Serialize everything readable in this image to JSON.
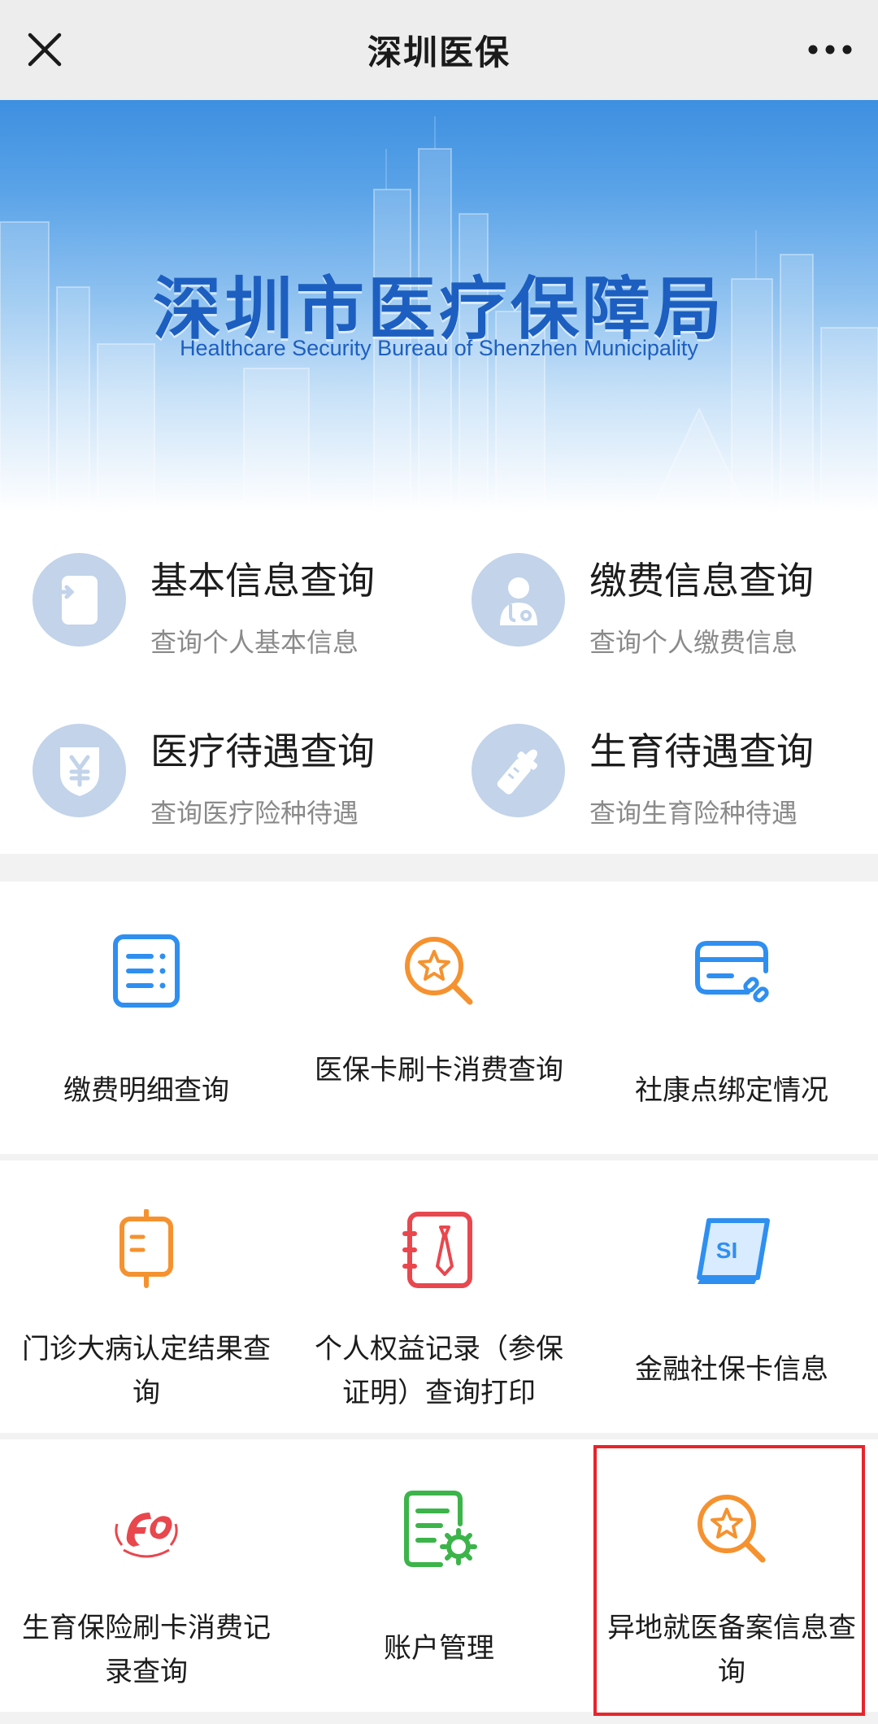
{
  "nav": {
    "title": "深圳医保",
    "close_icon": "close-icon",
    "more_icon": "more-dots-icon"
  },
  "banner": {
    "title": "深圳市医疗保障局",
    "subtitle": "Healthcare Security Bureau of Shenzhen Municipality",
    "color": "#1d5fc0"
  },
  "queries": [
    {
      "title": "基本信息查询",
      "desc": "查询个人基本信息",
      "icon": "id-card-icon"
    },
    {
      "title": "缴费信息查询",
      "desc": "查询个人缴费信息",
      "icon": "doctor-icon"
    },
    {
      "title": "医疗待遇查询",
      "desc": "查询医疗险种待遇",
      "icon": "yen-shield-icon"
    },
    {
      "title": "生育待遇查询",
      "desc": "查询生育险种待遇",
      "icon": "baby-bottle-icon"
    }
  ],
  "services": [
    {
      "label": "缴费明细查询",
      "icon": "list-document-icon",
      "color": "#2f8ff0"
    },
    {
      "label": "医保卡刷卡消费查询",
      "icon": "star-search-icon",
      "color": "#f5922f"
    },
    {
      "label": "社康点绑定情况",
      "icon": "card-link-icon",
      "color": "#2f8ff0"
    },
    {
      "label": "门诊大病认定结果查询",
      "icon": "iv-bag-icon",
      "color": "#f5922f"
    },
    {
      "label": "个人权益记录（参保证明）查询打印",
      "icon": "certificate-book-icon",
      "color": "#e8474e"
    },
    {
      "label": "金融社保卡信息",
      "icon": "si-card-icon",
      "color": "#2f8ff0"
    },
    {
      "label": "生育保险刷卡消费记录查询",
      "icon": "maternity-logo-icon",
      "color": "#e8474e"
    },
    {
      "label": "账户管理",
      "icon": "document-gear-icon",
      "color": "#3cb44a"
    },
    {
      "label": "异地就医备案信息查询",
      "icon": "star-search-icon",
      "color": "#f5922f"
    }
  ],
  "highlight": {
    "target": "异地就医备案信息查询",
    "color": "#e8242b"
  }
}
